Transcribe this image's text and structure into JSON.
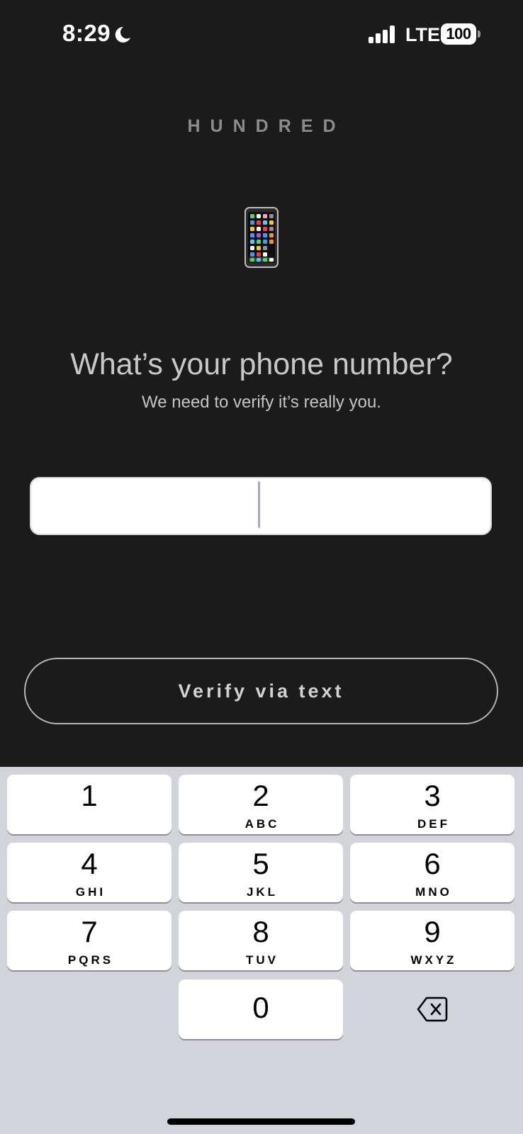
{
  "status_bar": {
    "time": "8:29",
    "network": "LTE",
    "battery": "100",
    "icons": [
      "moon-icon",
      "signal-icon",
      "battery-icon"
    ]
  },
  "brand": "HUNDRED",
  "hero_icon": "mobile-phone-icon",
  "headline": "What’s your phone number?",
  "subline": "We need to verify it’s really you.",
  "phone_input": {
    "value": "",
    "placeholder": ""
  },
  "verify_button": {
    "label": "Verify via text"
  },
  "keypad": {
    "keys": [
      {
        "digit": "1",
        "letters": ""
      },
      {
        "digit": "2",
        "letters": "ABC"
      },
      {
        "digit": "3",
        "letters": "DEF"
      },
      {
        "digit": "4",
        "letters": "GHI"
      },
      {
        "digit": "5",
        "letters": "JKL"
      },
      {
        "digit": "6",
        "letters": "MNO"
      },
      {
        "digit": "7",
        "letters": "PQRS"
      },
      {
        "digit": "8",
        "letters": "TUV"
      },
      {
        "digit": "9",
        "letters": "WXYZ"
      },
      {
        "digit": "0",
        "letters": ""
      }
    ],
    "delete_icon": "backspace-icon"
  },
  "colors": {
    "background": "#1b1b1c",
    "keypad_background": "#d1d4db",
    "caret": "#a9a6d6",
    "text_muted": "#c8c8c8"
  }
}
